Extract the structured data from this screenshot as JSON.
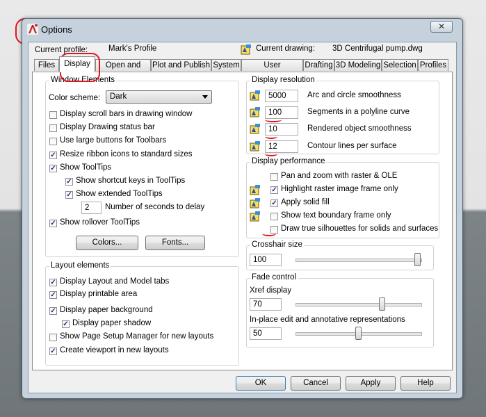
{
  "window": {
    "title": "Options",
    "close_glyph": "✕",
    "app_icon": "autocad-a-icon"
  },
  "profile": {
    "current_profile_label": "Current profile:",
    "current_profile_value": "Mark's Profile",
    "current_drawing_label": "Current drawing:",
    "current_drawing_value": "3D Centrifugal pump.dwg"
  },
  "tabs": [
    {
      "label": "Files"
    },
    {
      "label": "Display",
      "active": true
    },
    {
      "label": "Open and Save"
    },
    {
      "label": "Plot and Publish"
    },
    {
      "label": "System"
    },
    {
      "label": "User Preferences"
    },
    {
      "label": "Drafting"
    },
    {
      "label": "3D Modeling"
    },
    {
      "label": "Selection"
    },
    {
      "label": "Profiles"
    }
  ],
  "window_elements": {
    "title": "Window Elements",
    "color_scheme_label": "Color scheme:",
    "color_scheme_value": "Dark",
    "checkboxes": [
      {
        "label": "Display scroll bars in drawing window",
        "checked": false
      },
      {
        "label": "Display Drawing status bar",
        "checked": false
      },
      {
        "label": "Use large buttons for Toolbars",
        "checked": false
      },
      {
        "label": "Resize ribbon icons to standard sizes",
        "checked": true
      },
      {
        "label": "Show ToolTips",
        "checked": true
      },
      {
        "label": "Show shortcut keys in ToolTips",
        "checked": true
      },
      {
        "label": "Show extended ToolTips",
        "checked": true
      }
    ],
    "seconds_value": "2",
    "seconds_label": "Number of seconds to delay",
    "rollover": {
      "label": "Show rollover ToolTips",
      "checked": true
    },
    "colors_button": "Colors...",
    "fonts_button": "Fonts..."
  },
  "layout_elements": {
    "title": "Layout elements",
    "checkboxes": [
      {
        "label": "Display Layout and Model tabs",
        "checked": true
      },
      {
        "label": "Display printable area",
        "checked": true
      },
      {
        "label": "Display paper background",
        "checked": true
      },
      {
        "label": "Display paper shadow",
        "checked": true
      },
      {
        "label": "Show Page Setup Manager for new layouts",
        "checked": false
      },
      {
        "label": "Create viewport in new layouts",
        "checked": true
      }
    ]
  },
  "display_resolution": {
    "title": "Display resolution",
    "rows": [
      {
        "value": "5000",
        "label": "Arc and circle smoothness"
      },
      {
        "value": "100",
        "label": "Segments in a polyline curve"
      },
      {
        "value": "10",
        "label": "Rendered object smoothness"
      },
      {
        "value": "12",
        "label": "Contour lines per surface"
      }
    ]
  },
  "display_performance": {
    "title": "Display performance",
    "checkboxes": [
      {
        "label": "Pan and zoom with raster & OLE",
        "checked": false
      },
      {
        "label": "Highlight raster image frame only",
        "checked": true
      },
      {
        "label": "Apply solid fill",
        "checked": true
      },
      {
        "label": "Show text boundary frame only",
        "checked": false
      },
      {
        "label": "Draw true silhouettes for solids and surfaces",
        "checked": false
      }
    ]
  },
  "crosshair": {
    "title": "Crosshair size",
    "value": "100",
    "slider_fraction": 1.0
  },
  "fade": {
    "title": "Fade control",
    "xref_label": "Xref display",
    "xref_value": "70",
    "xref_fraction": 0.7,
    "inplace_label": "In-place edit and annotative representations",
    "inplace_value": "50",
    "inplace_fraction": 0.5
  },
  "buttons": {
    "ok": "OK",
    "cancel": "Cancel",
    "apply": "Apply",
    "help": "Help"
  },
  "colors": {
    "annotation_red": "#e0141f",
    "check_color": "#262a7a"
  }
}
